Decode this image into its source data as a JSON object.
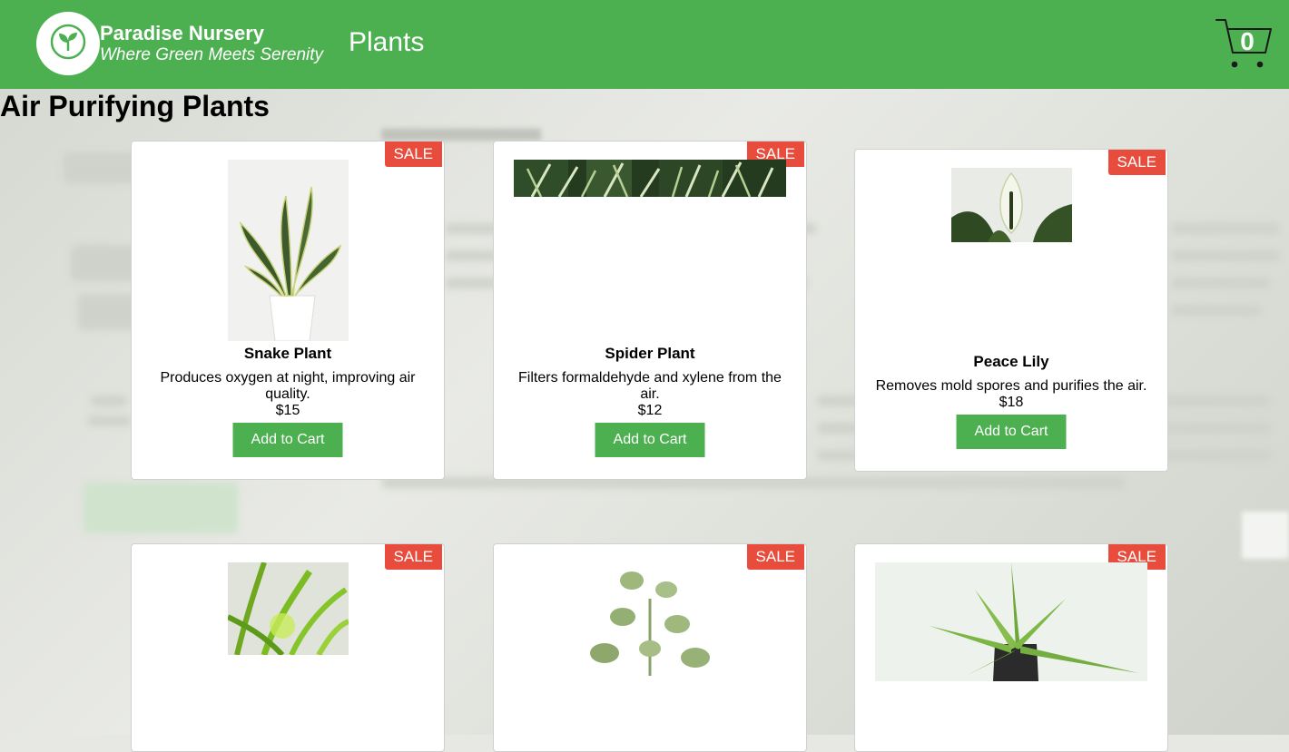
{
  "header": {
    "brand_name": "Paradise Nursery",
    "brand_tagline": "Where Green Meets Serenity",
    "nav_plants": "Plants",
    "cart_count": "0",
    "logo_icon": "leaf-icon",
    "cart_icon": "shopping-cart-icon"
  },
  "section": {
    "title": "Air Purifying Plants"
  },
  "products": [
    {
      "name": "Snake Plant",
      "description": "Produces oxygen at night, improving air quality.",
      "price": "$15",
      "badge": "SALE",
      "button": "Add to Cart"
    },
    {
      "name": "Spider Plant",
      "description": "Filters formaldehyde and xylene from the air.",
      "price": "$12",
      "badge": "SALE",
      "button": "Add to Cart"
    },
    {
      "name": "Peace Lily",
      "description": "Removes mold spores and purifies the air.",
      "price": "$18",
      "badge": "SALE",
      "button": "Add to Cart"
    },
    {
      "badge": "SALE"
    },
    {
      "badge": "SALE"
    },
    {
      "badge": "SALE"
    }
  ],
  "colors": {
    "header_green": "#4caf50",
    "button_green": "#4caf50",
    "sale_red": "#e74c3c"
  }
}
